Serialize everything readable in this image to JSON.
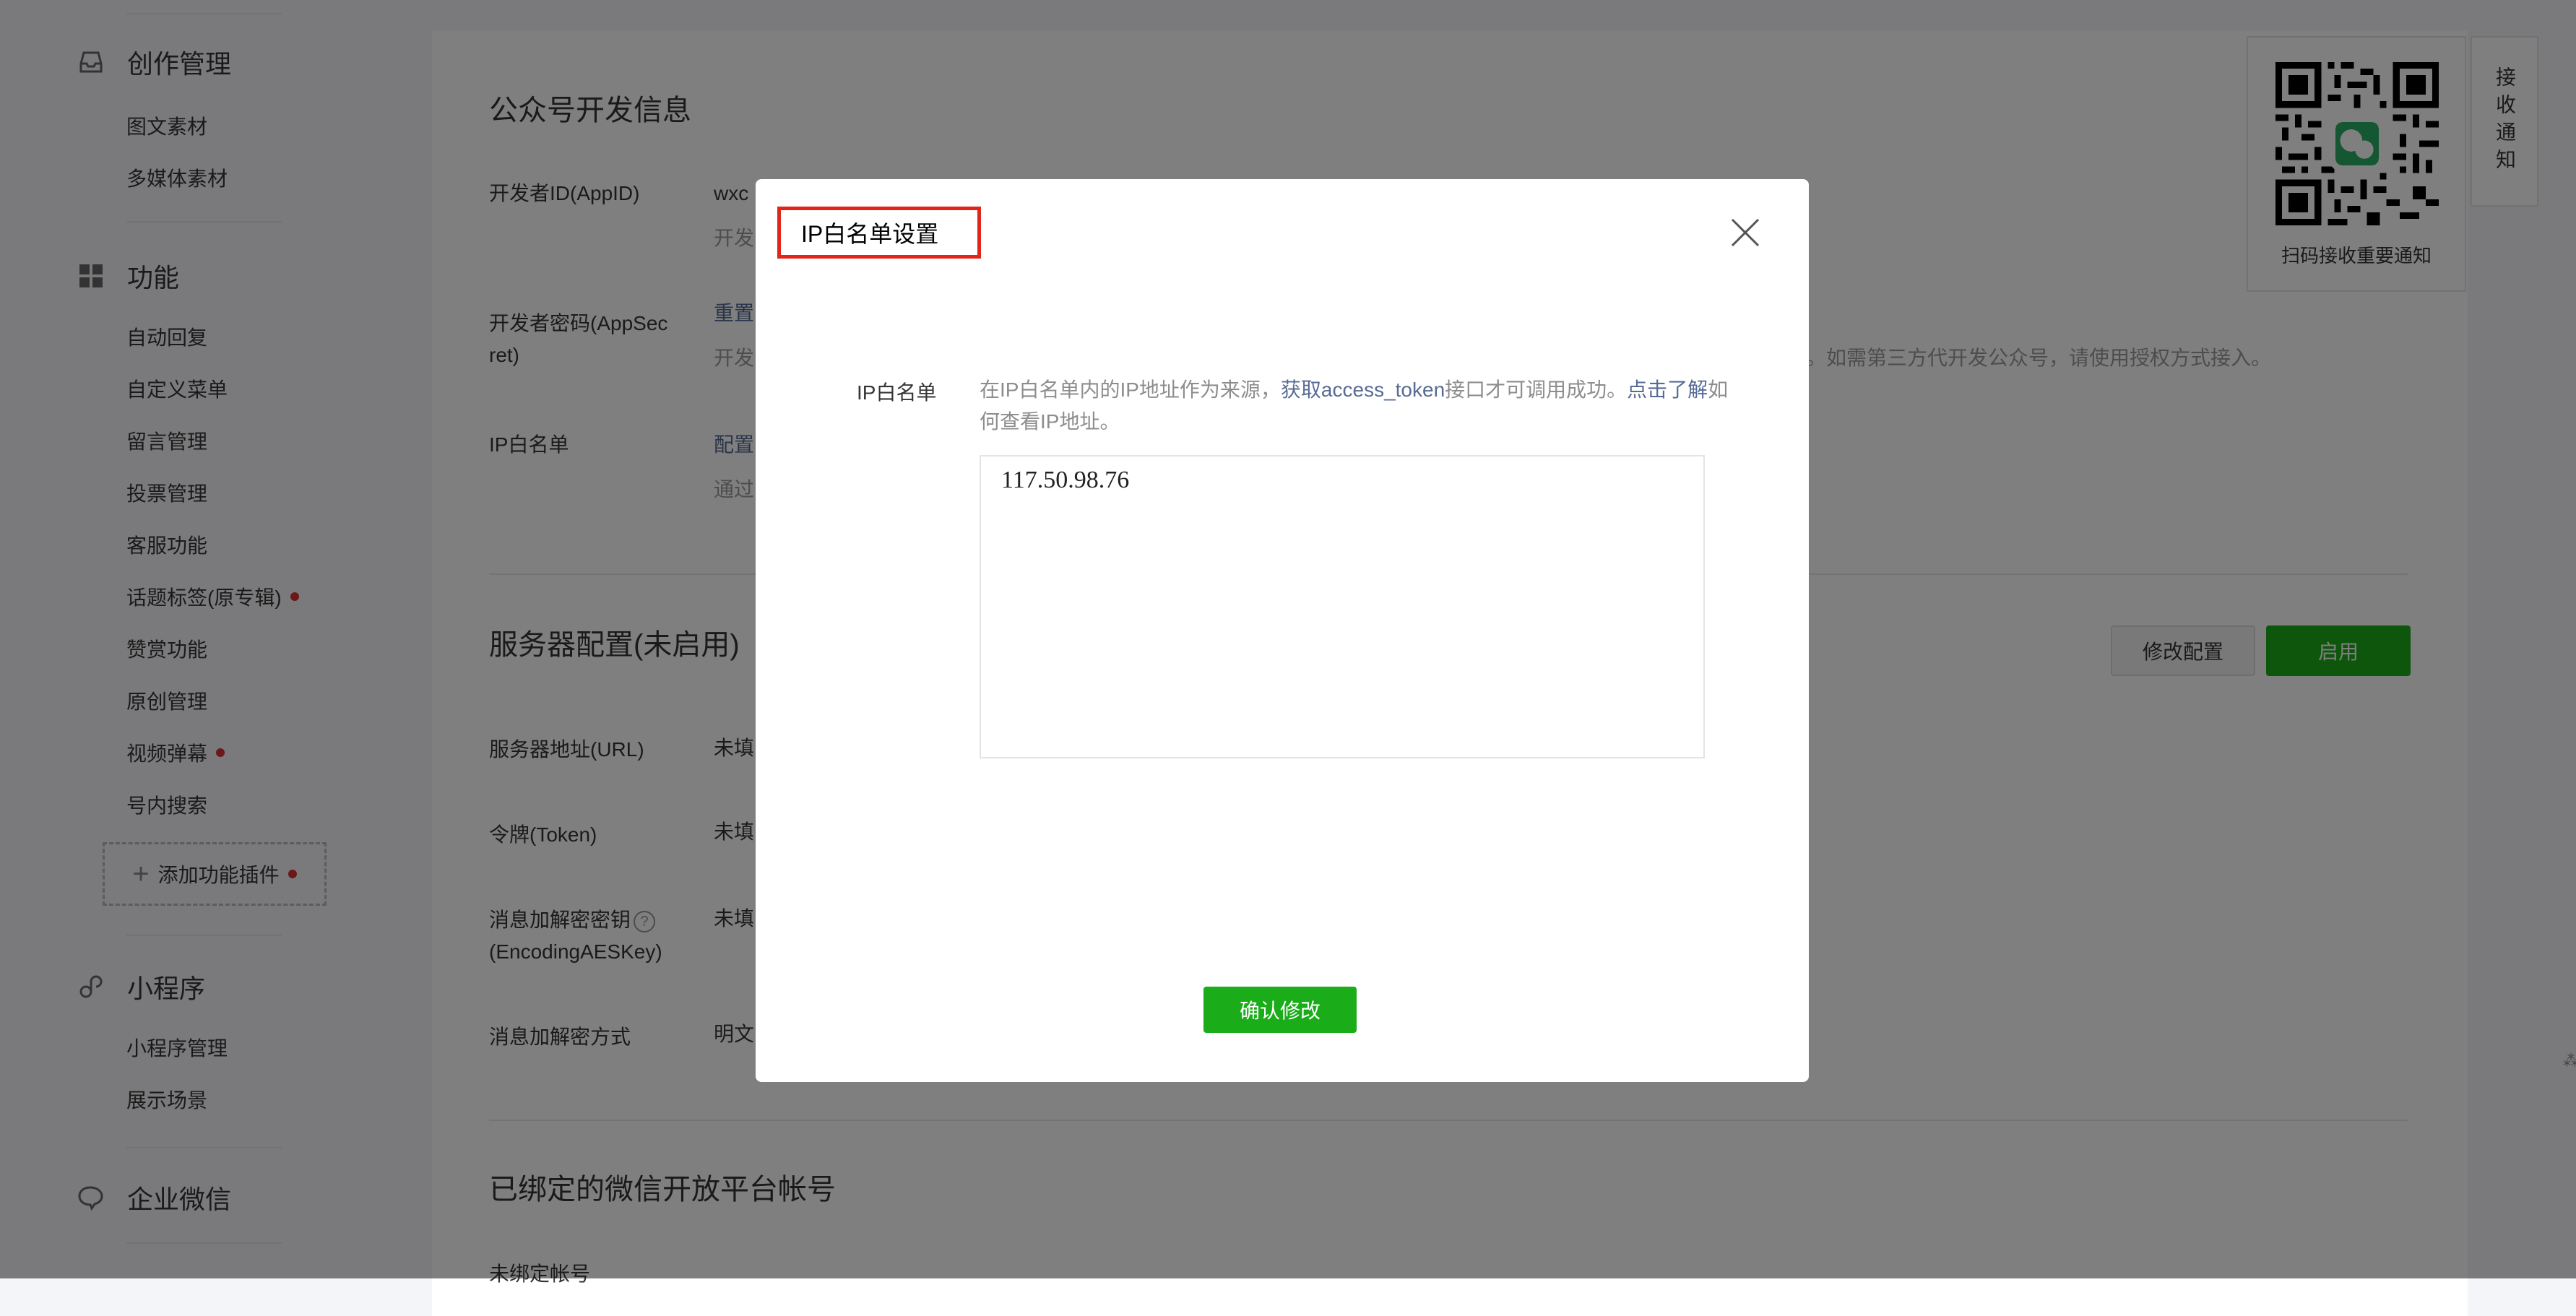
{
  "sidebar": {
    "groups": {
      "creation": {
        "label": "创作管理",
        "icon": "inbox-icon"
      },
      "features": {
        "label": "功能",
        "icon": "grid-icon"
      },
      "miniprogram": {
        "label": "小程序",
        "icon": "link-icon"
      },
      "wecom": {
        "label": "企业微信",
        "icon": "chat-bubble-icon"
      }
    },
    "creation_items": [
      "图文素材",
      "多媒体素材"
    ],
    "feature_items": [
      "自动回复",
      "自定义菜单",
      "留言管理",
      "投票管理",
      "客服功能",
      "话题标签(原专辑)",
      "赞赏功能",
      "原创管理",
      "视频弹幕",
      "号内搜索"
    ],
    "add_plugin": "添加功能插件",
    "miniprogram_items": [
      "小程序管理",
      "展示场景"
    ]
  },
  "main": {
    "dev_info": {
      "title": "公众号开发信息",
      "appid_label": "开发者ID(AppID)",
      "appid_value": "wxc",
      "appid_hint": "开发",
      "secret_label_line1": "开发者密码(AppSec",
      "secret_label_line2": "ret)",
      "secret_link": "重置",
      "secret_hint_left": "开发",
      "secret_hint_right": "。如需第三方代开发公众号，请使用授权方式接入。",
      "ip_label": "IP白名单",
      "ip_link": "配置",
      "ip_hint": "通过"
    },
    "server": {
      "title": "服务器配置(未启用)",
      "modify_button": "修改配置",
      "enable_button": "启用",
      "url_label": "服务器地址(URL)",
      "url_value": "未填",
      "token_label": "令牌(Token)",
      "token_value": "未填",
      "aes_label_line1": "消息加解密密钥",
      "aes_label_line2": "(EncodingAESKey)",
      "aes_value": "未填",
      "mode_label": "消息加解密方式",
      "mode_value": "明文"
    },
    "open_platform": {
      "title": "已绑定的微信开放平台帐号",
      "unbound_label": "未绑定帐号"
    }
  },
  "qr_panel": {
    "caption": "扫码接收重要通知",
    "notice_tab": "接收通知"
  },
  "dialog": {
    "title": "IP白名单设置",
    "field_label": "IP白名单",
    "desc_part1": "在IP白名单内的IP地址作为来源，",
    "desc_link1": "获取access_token",
    "desc_part2": "接口才可调用成功。",
    "desc_link2": "点击了解",
    "desc_part3": "如何查看IP地址。",
    "ip_value": "117.50.98.76",
    "confirm_button": "确认修改"
  },
  "colors": {
    "primary_green": "#1aad19",
    "link_blue": "#576b95",
    "highlight_red": "#e1251b",
    "badge_red": "#d43030"
  }
}
